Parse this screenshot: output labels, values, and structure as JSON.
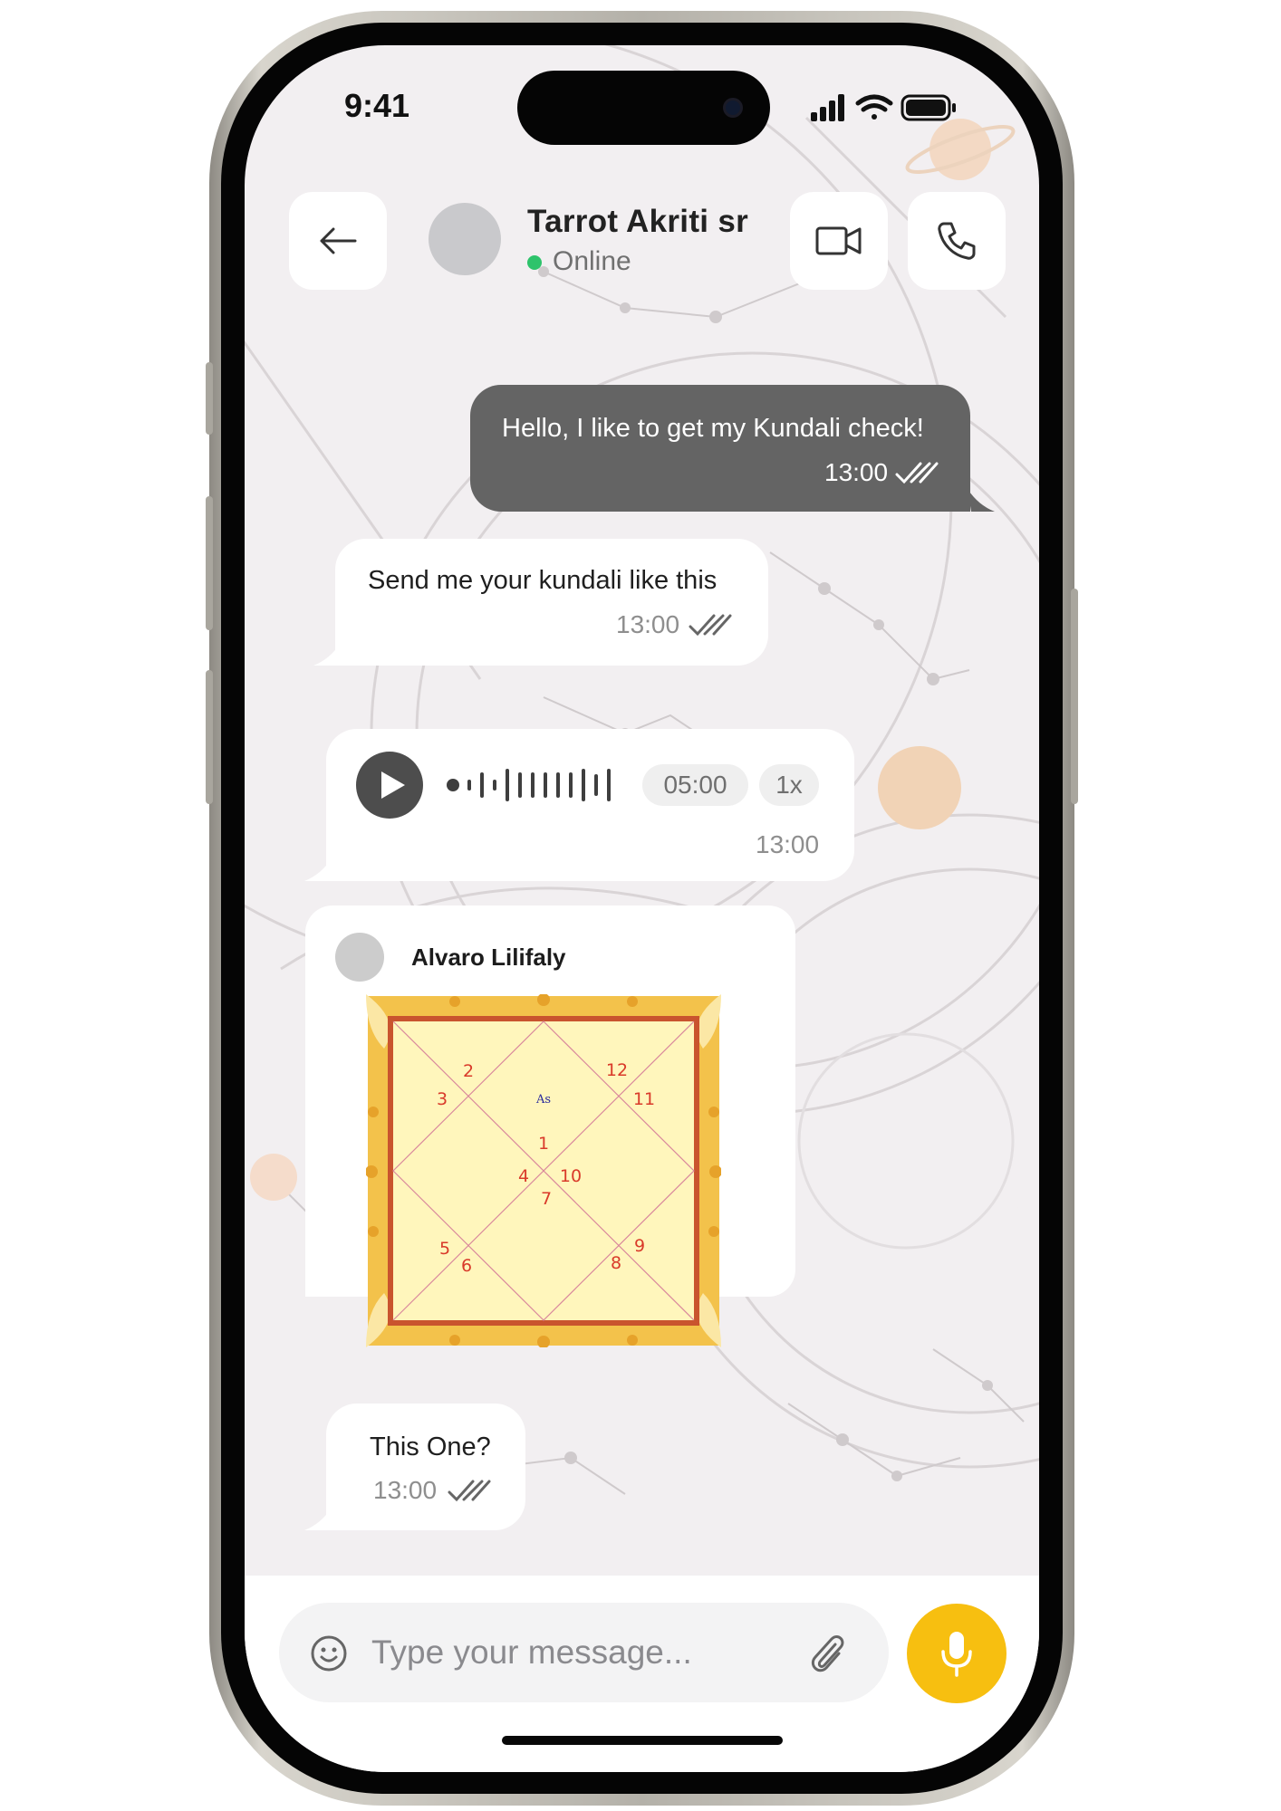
{
  "status_bar": {
    "time": "9:41"
  },
  "header": {
    "back_icon": "arrow-left-icon",
    "contact_name": "Tarrot Akriti sr",
    "status": "Online",
    "status_color": "#2ec36b",
    "video_icon": "video-camera-icon",
    "call_icon": "phone-icon"
  },
  "messages": [
    {
      "direction": "outgoing",
      "type": "text",
      "text": "Hello, I like to get my Kundali check!",
      "time": "13:00",
      "status": "read"
    },
    {
      "direction": "incoming",
      "type": "text",
      "text": "Send me your kundali like this",
      "time": "13:00",
      "status": "read"
    },
    {
      "direction": "incoming",
      "type": "voice",
      "duration": "05:00",
      "speed": "1x",
      "time": "13:00",
      "status_icon": "play-icon"
    },
    {
      "direction": "incoming",
      "type": "image",
      "sender": "Alvaro Lilifaly",
      "image": {
        "kind": "kundali-chart",
        "center_label": "As",
        "house_numbers": [
          "1",
          "2",
          "3",
          "4",
          "5",
          "6",
          "7",
          "8",
          "9",
          "10",
          "11",
          "12"
        ]
      }
    },
    {
      "direction": "incoming",
      "type": "text",
      "text": "This One?",
      "time": "13:00",
      "status": "read"
    }
  ],
  "composer": {
    "placeholder": "Type your message...",
    "emoji_icon": "smiley-icon",
    "attach_icon": "paperclip-icon",
    "mic_icon": "microphone-icon",
    "mic_color": "#f7bf10"
  },
  "colors": {
    "outgoing_bubble": "#646464",
    "incoming_bubble": "#ffffff",
    "chat_background": "#f2eff1"
  }
}
